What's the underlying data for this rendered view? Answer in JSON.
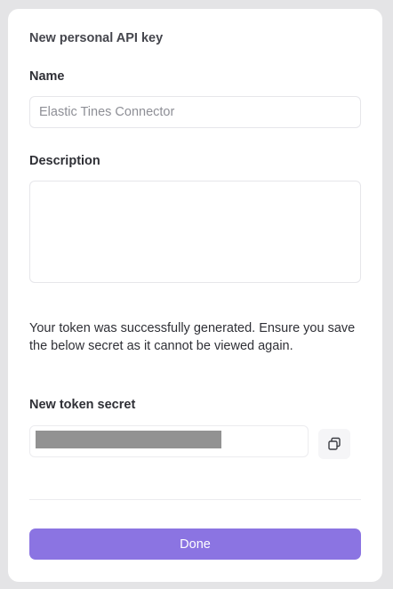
{
  "dialog": {
    "title": "New personal API key"
  },
  "name_field": {
    "label": "Name",
    "placeholder": "Elastic Tines Connector",
    "value": ""
  },
  "description_field": {
    "label": "Description",
    "value": ""
  },
  "notice": {
    "text": "Your token was successfully generated. Ensure you save the below secret as it cannot be viewed again."
  },
  "secret_field": {
    "label": "New token secret",
    "copy_icon": "copy-icon"
  },
  "actions": {
    "done_label": "Done"
  },
  "colors": {
    "accent": "#8b74e2",
    "mask": "#929292"
  }
}
